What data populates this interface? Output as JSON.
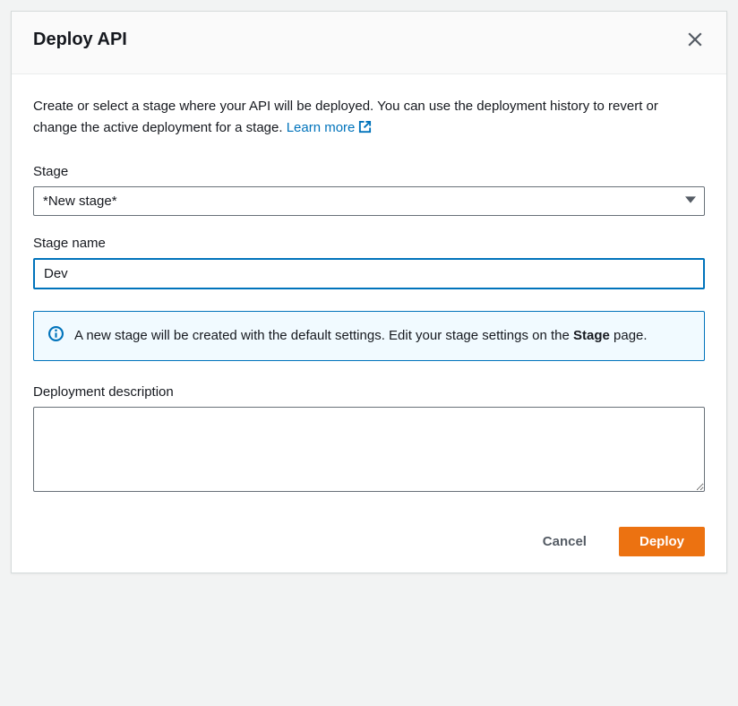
{
  "modal": {
    "title": "Deploy API",
    "description_part1": "Create or select a stage where your API will be deployed. You can use the deployment history to revert or change the active deployment for a stage. ",
    "learn_more_label": "Learn more"
  },
  "form": {
    "stage_label": "Stage",
    "stage_selected": "*New stage*",
    "stage_name_label": "Stage name",
    "stage_name_value": "Dev",
    "info_text_part1": "A new stage will be created with the default settings. Edit your stage settings on the ",
    "info_text_bold": "Stage",
    "info_text_part2": " page.",
    "description_label": "Deployment description",
    "description_value": ""
  },
  "footer": {
    "cancel_label": "Cancel",
    "deploy_label": "Deploy"
  }
}
